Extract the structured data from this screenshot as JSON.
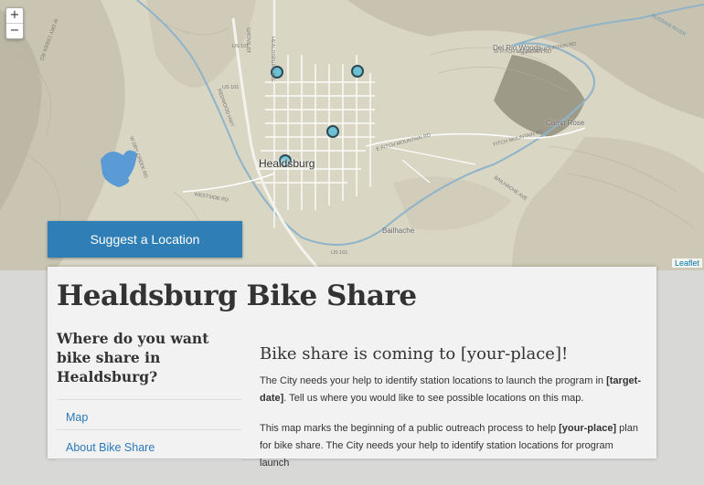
{
  "map": {
    "zoom_in": "+",
    "zoom_out": "−",
    "town_label": "Healdsburg",
    "attribution": "Leaflet",
    "suggest_button": "Suggest a Location",
    "place_labels": [
      "Del Rio Woods",
      "Camp Rose",
      "Bailhache"
    ],
    "road_labels": [
      "US 101",
      "US 101",
      "US 101",
      "HEALDSBURG AVE",
      "GROVE ST",
      "REDWOOD HWY",
      "W FITCH MOUNTAIN RD",
      "E FITCH MOUNTAIN RD",
      "FITCH MOUNTAIN RD",
      "WESTSIDE RD",
      "BAILHACHE AVE",
      "W DRY CREEK RD",
      "W DRY CREEK RD",
      "S FITCH MOUNTAIN RD",
      "RUSSIAN RIVER"
    ]
  },
  "page": {
    "title": "Healdsburg Bike Share",
    "sidebar_heading": "Where do you want bike share in Healdsburg?",
    "nav": [
      "Map",
      "About Bike Share"
    ]
  },
  "content": {
    "heading": "Bike share is coming to [your-place]!",
    "p1_a": "The City needs your help to identify station locations to launch the program in ",
    "p1_b": "[target-date]",
    "p1_c": ". Tell us where you would like to see possible locations on this map.",
    "p2_a": "This map marks the beginning of a public outreach process to help ",
    "p2_b": "[your-place]",
    "p2_c": " plan for bike share. The City needs your help to identify station locations for program launch"
  },
  "colors": {
    "button": "#2f7eb5",
    "marker_fill": "#6cc1d3",
    "marker_stroke": "#2c4a55",
    "water": "#5b9bd5"
  }
}
